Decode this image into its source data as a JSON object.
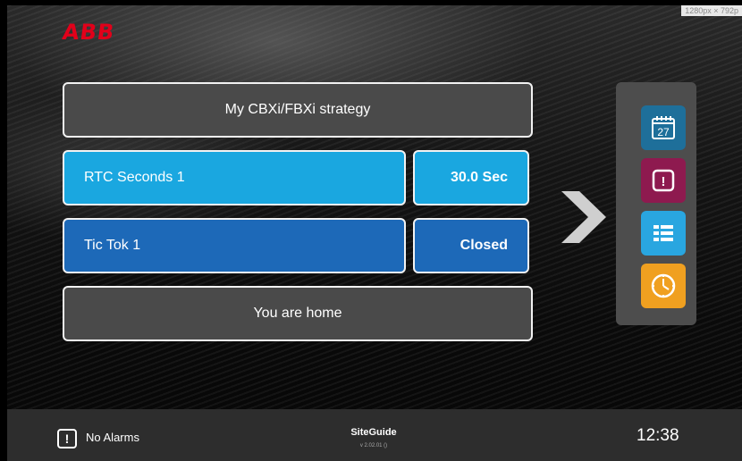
{
  "brand": {
    "logo_text": "ABB"
  },
  "screen": {
    "resolution_badge": "1280px × 792p"
  },
  "tiles": {
    "title": "My CBXi/FBXi strategy",
    "rtc_label": "RTC Seconds 1",
    "rtc_value": "30.0 Sec",
    "tic_label": "Tic Tok 1",
    "tic_value": "Closed",
    "home": "You are home"
  },
  "side_menu": {
    "items": [
      {
        "icon": "calendar-icon",
        "text": "27",
        "color": "#1e6f9a"
      },
      {
        "icon": "alarm-icon",
        "text": "!",
        "color": "#8e1a4f"
      },
      {
        "icon": "list-icon",
        "color": "#29a6e0"
      },
      {
        "icon": "clock-icon",
        "color": "#f0a020"
      }
    ]
  },
  "status_bar": {
    "alarm_icon_text": "!",
    "alarm_text": "No Alarms",
    "app_name": "SiteGuide",
    "version": "v 2.02.01 ()",
    "time": "12:38"
  },
  "colors": {
    "tile_gray": "#4a4a4a",
    "tile_light_blue": "#1aa7e0",
    "tile_dark_blue": "#1d69b8",
    "abb_red": "#e2001a"
  }
}
